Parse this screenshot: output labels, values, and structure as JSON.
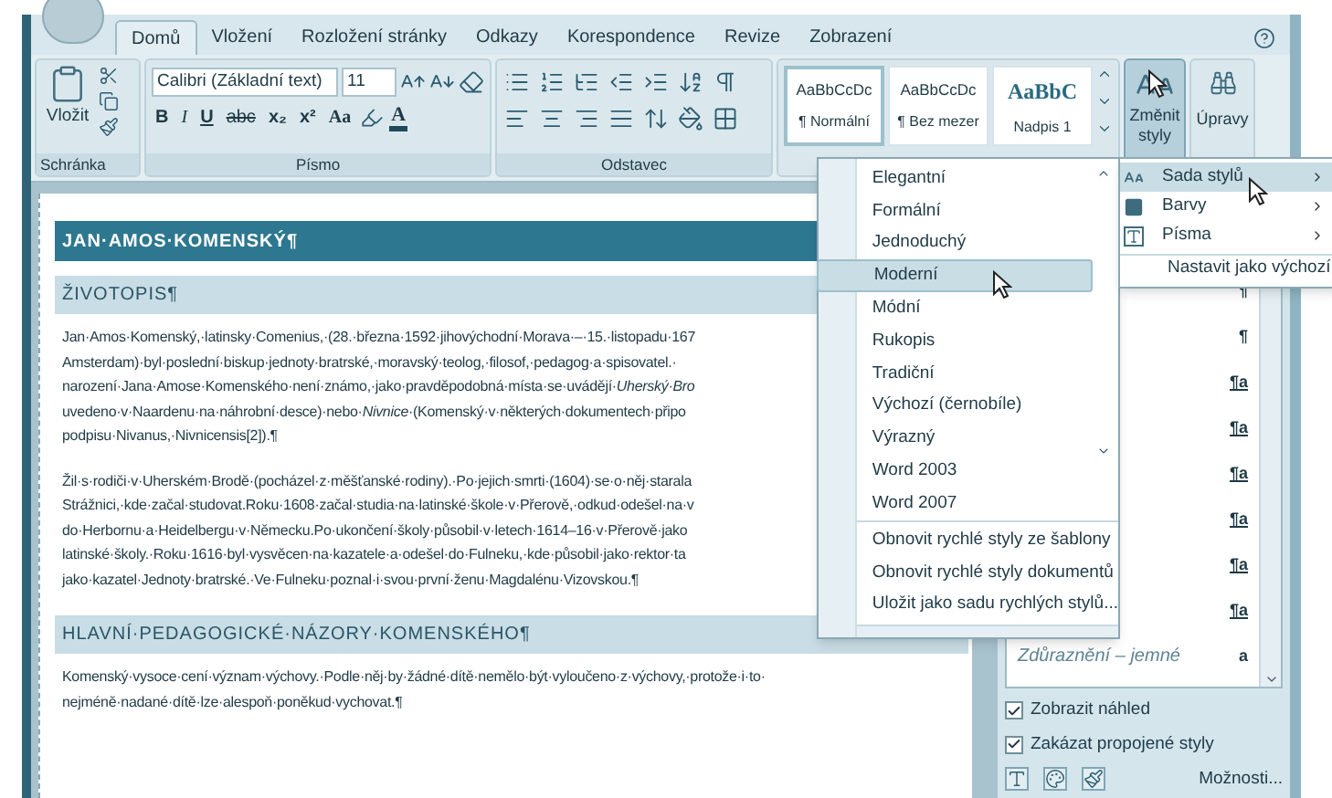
{
  "tabs": [
    {
      "label": "Domů",
      "selected": true
    },
    {
      "label": "Vložení",
      "selected": false
    },
    {
      "label": "Rozložení stránky",
      "selected": false
    },
    {
      "label": "Odkazy",
      "selected": false
    },
    {
      "label": "Korespondence",
      "selected": false
    },
    {
      "label": "Revize",
      "selected": false
    },
    {
      "label": "Zobrazení",
      "selected": false
    }
  ],
  "ribbon": {
    "clipboard": {
      "paste": "Vložit",
      "label": "Schránka"
    },
    "font": {
      "name": "Calibri (Základní text)",
      "size": "11",
      "label": "Písmo",
      "format_buttons": [
        {
          "label": "B",
          "kind": "bold"
        },
        {
          "label": "I",
          "kind": "italic"
        },
        {
          "label": "U",
          "kind": "underline"
        },
        {
          "label": "abc",
          "kind": "strike"
        },
        {
          "label": "x₂",
          "kind": "sub"
        },
        {
          "label": "x²",
          "kind": "sup"
        },
        {
          "label": "Aa",
          "kind": "case"
        }
      ],
      "color_letter": "A"
    },
    "paragraph": {
      "label": "Odstavec"
    },
    "quick_styles": [
      {
        "sample": "AaBbCcDc",
        "name": "¶ Normální",
        "kind": "normal",
        "selected": true
      },
      {
        "sample": "AaBbCcDc",
        "name": "¶ Bez mezer",
        "kind": "normal",
        "selected": false
      },
      {
        "sample": "AaBbC",
        "name": "Nadpis 1",
        "kind": "heading",
        "selected": false
      }
    ],
    "change_styles": {
      "label": "Změnit styly",
      "pressed": true
    },
    "editing": {
      "label": "Úpravy"
    }
  },
  "document": {
    "blocks": [
      {
        "kind": "title",
        "text": "JAN·AMOS·KOMENSKÝ¶"
      },
      {
        "kind": "heading",
        "text": "ŽIVOTOPIS¶"
      },
      {
        "kind": "paragraph",
        "lines": [
          "Jan·Amos·Komenský,·latinsky·Comenius,·(28.·března·1592·jihovýchodní·Morava·–·15.·listopadu·167",
          "Amsterdam)·byl·poslední·biskup·jednoty·bratrské,·moravský·teolog,·filosof,·pedagog·a·spisovatel.·",
          "narození·Jana·Amose·Komenského·není·známo,·jako·pravděpodobná·místa·se·uvádějí·*Uherský·Bro*",
          "uvedeno·v·Naardenu·na·náhrobní·desce)·nebo·*Nivnice*·(Komenský·v·některých·dokumentech·připo",
          "podpisu·Nivanus,·Nivnicensis[2]).¶"
        ]
      },
      {
        "kind": "paragraph",
        "lines": [
          "Žil·s·rodiči·v·Uherském·Brodě·(pocházel·z·měšťanské·rodiny).·Po·jejich·smrti·(1604)·se·o·něj·starala",
          "Strážnici,·kde·začal·studovat.Roku·1608·začal·studia·na·latinské·škole·v·Přerově,·odkud·odešel·na·v",
          "do·Herbornu·a·Heidelbergu·v·Německu.Po·ukončení·školy·působil·v·letech·1614–16·v·Přerově·jako",
          "latinské·školy.·Roku·1616·byl·vysvěcen·na·kazatele·a·odešel·do·Fulneku,·kde·působil·jako·rektor·ta",
          "jako·kazatel·Jednoty·bratrské.·Ve·Fulneku·poznal·i·svou·první·ženu·Magdalénu·Vizovskou.¶"
        ]
      },
      {
        "kind": "heading",
        "text": "HLAVNÍ·PEDAGOGICKÉ·NÁZORY·KOMENSKÉHO¶"
      },
      {
        "kind": "paragraph",
        "lines": [
          "Komenský·vysoce·cení·význam·výchovy.·Podle·něj·by·žádné·dítě·nemělo·být·vyloučeno·z·výchovy,·protože·i·to·",
          "nejméně·nadané·dítě·lze·alespoň·poněkud·vychovat.¶"
        ]
      }
    ]
  },
  "style_set_menu": {
    "items": [
      {
        "label": "Elegantní",
        "selected": false
      },
      {
        "label": "Formální",
        "selected": false
      },
      {
        "label": "Jednoduchý",
        "selected": false
      },
      {
        "label": "Moderní",
        "selected": true
      },
      {
        "label": "Módní",
        "selected": false
      },
      {
        "label": "Rukopis",
        "selected": false
      },
      {
        "label": "Tradiční",
        "selected": false
      },
      {
        "label": "Výchozí (černobíle)",
        "selected": false
      },
      {
        "label": "Výrazný",
        "selected": false
      },
      {
        "label": "Word 2003",
        "selected": false
      },
      {
        "label": "Word 2007",
        "selected": false
      }
    ],
    "commands": [
      "Obnovit rychlé styly ze šablony",
      "Obnovit rychlé styly dokumentů",
      "Uložit jako sadu rychlých stylů..."
    ]
  },
  "submenu": {
    "items": [
      {
        "label": "Sada stylů",
        "kind": "submenu",
        "selected": true
      },
      {
        "label": "Barvy",
        "kind": "submenu",
        "selected": false
      },
      {
        "label": "Písma",
        "kind": "submenu",
        "selected": false
      },
      {
        "label": "Nastavit jako výchozí",
        "kind": "command",
        "selected": false
      }
    ]
  },
  "styles_pane": {
    "items": [
      {
        "mark": "¶"
      },
      {
        "mark": "¶"
      },
      {
        "mark": "¶a"
      },
      {
        "mark": "¶a"
      },
      {
        "mark": "¶a"
      },
      {
        "mark": "¶a"
      },
      {
        "mark": "¶a"
      },
      {
        "mark": "¶a"
      },
      {
        "name": "Zdůraznění – jemné",
        "mark": "a"
      }
    ],
    "options": [
      {
        "label": "Zobrazit náhled",
        "checked": true
      },
      {
        "label": "Zakázat propojené styly",
        "checked": true
      }
    ],
    "link": "Možnosti..."
  }
}
